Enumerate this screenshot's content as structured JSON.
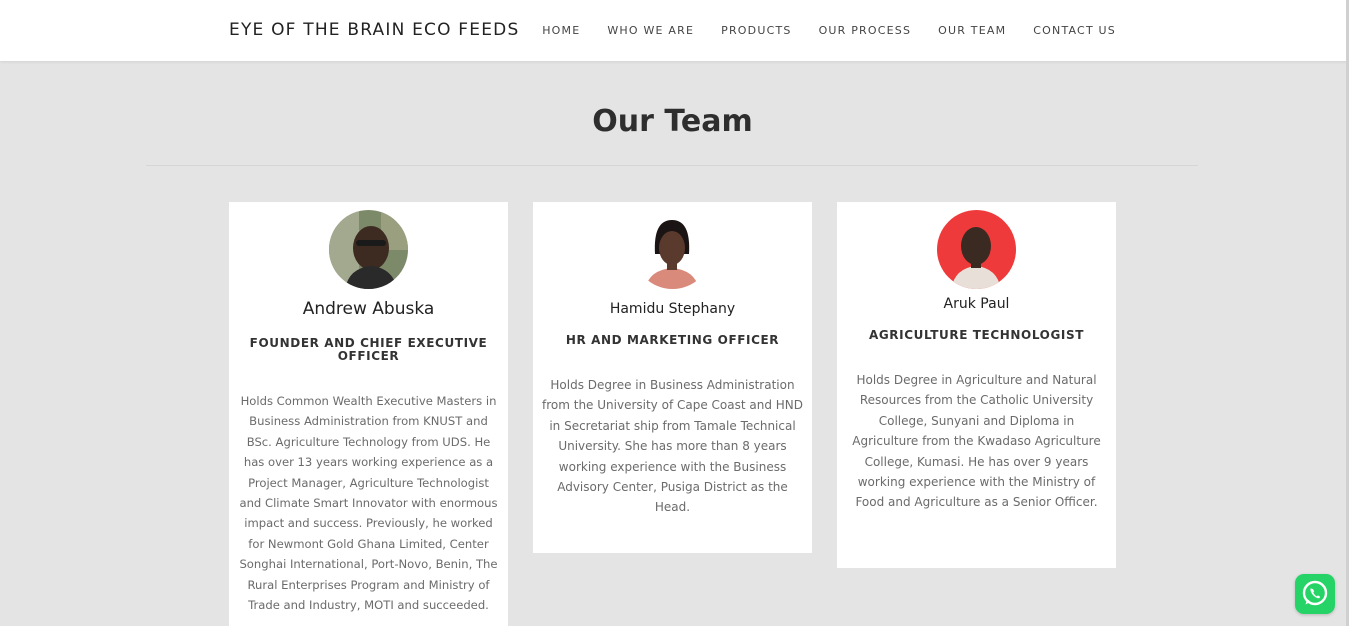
{
  "header": {
    "brand": "EYE OF THE BRAIN ECO FEEDS",
    "nav": [
      "HOME",
      "WHO WE ARE",
      "PRODUCTS",
      "OUR PROCESS",
      "OUR TEAM",
      "CONTACT US"
    ]
  },
  "section": {
    "title": "Our Team"
  },
  "team": [
    {
      "name": "Andrew Abuska",
      "role": "FOUNDER AND CHIEF EXECUTIVE OFFICER",
      "bio": "Holds Common Wealth Executive Masters in Business Administration from KNUST and BSc. Agriculture Technology from UDS. He has over 13 years working experience as a Project Manager, Agriculture Technologist and Climate Smart Innovator with enormous impact and success. Previously, he worked for Newmont Gold Ghana Limited, Center Songhai International, Port-Novo, Benin, The Rural Enterprises Program and Ministry of Trade and Industry, MOTI and succeeded."
    },
    {
      "name": "Hamidu Stephany",
      "role": "HR AND MARKETING OFFICER",
      "bio": "Holds Degree in Business Administration from the University of Cape Coast and HND in Secretariat ship from Tamale Technical University. She has more than 8 years working experience with the Business Advisory Center, Pusiga District as the Head."
    },
    {
      "name": "Aruk Paul",
      "role": "AGRICULTURE TECHNOLOGIST",
      "bio": "Holds Degree in Agriculture and Natural Resources from the Catholic University College, Sunyani and Diploma in Agriculture from the Kwadaso Agriculture College, Kumasi. He has over 9 years working experience with the Ministry of Food and Agriculture as a Senior Officer."
    }
  ],
  "icons": {
    "whatsapp": "whatsapp-icon"
  },
  "colors": {
    "page_background": "#e4e4e4",
    "card_background": "#ffffff",
    "whatsapp_green": "#25d366",
    "avatar3_background": "#ee3a3a"
  }
}
